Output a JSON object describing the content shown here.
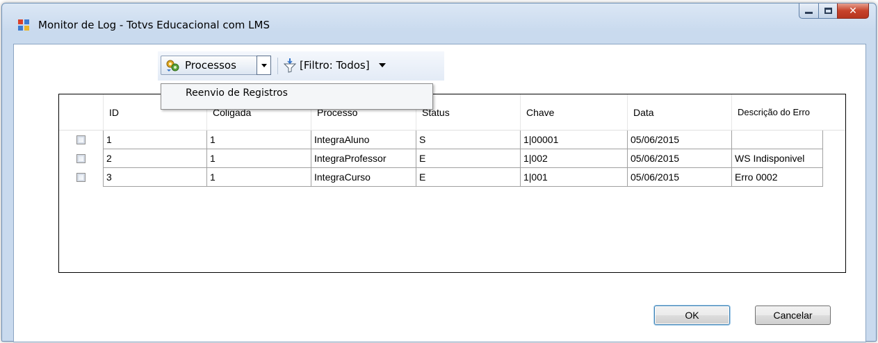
{
  "window": {
    "title": "Monitor de Log - Totvs Educacional com LMS",
    "close_glyph": "✕"
  },
  "toolbar": {
    "processos_label": "Processos",
    "filter_label": "[Filtro: Todos]"
  },
  "menu": {
    "items": [
      {
        "label": "Reenvio de Registros"
      }
    ]
  },
  "grid": {
    "columns": [
      "ID",
      "Coligada",
      "Processo",
      "Status",
      "Chave",
      "Data",
      "Descrição do Erro"
    ],
    "rows": [
      {
        "id": "1",
        "coligada": "1",
        "processo": "IntegraAluno",
        "status": "S",
        "chave": "1|00001",
        "data": "05/06/2015",
        "erro": ""
      },
      {
        "id": "2",
        "coligada": "1",
        "processo": "IntegraProfessor",
        "status": "E",
        "chave": "1|002",
        "data": "05/06/2015",
        "erro": "WS Indisponivel"
      },
      {
        "id": "3",
        "coligada": "1",
        "processo": "IntegraCurso",
        "status": "E",
        "chave": "1|001",
        "data": "05/06/2015",
        "erro": "Erro 0002"
      }
    ]
  },
  "buttons": {
    "ok": "OK",
    "cancel": "Cancelar"
  },
  "icons": {
    "app": "app-window-icon",
    "processos": "gear-process-icon",
    "filter": "funnel-filter-icon"
  }
}
